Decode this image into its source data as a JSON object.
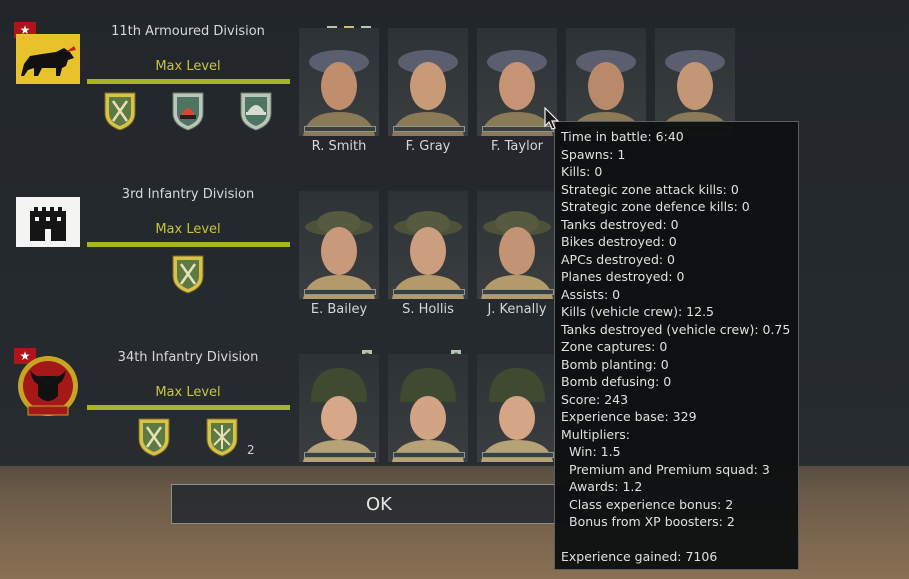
{
  "divisions": [
    {
      "name": "11th Armoured Division",
      "level": "Max Level",
      "flag_icon": "charging-bull-flag",
      "awards": [
        "crossed-swords-award",
        "flame-award",
        "helmet-award"
      ],
      "award_count": "",
      "soldiers": [
        {
          "name": "R. Smith",
          "headgear": "beret"
        },
        {
          "name": "F. Gray",
          "headgear": "beret"
        },
        {
          "name": "F. Taylor",
          "headgear": "beret"
        },
        {
          "name": "",
          "headgear": "beret"
        },
        {
          "name": "",
          "headgear": "beret"
        }
      ]
    },
    {
      "name": "3rd Infantry Division",
      "level": "Max Level",
      "flag_icon": "castle-flag",
      "awards": [
        "crossed-swords-award"
      ],
      "award_count": "",
      "soldiers": [
        {
          "name": "E. Bailey",
          "headgear": "brodie-helmet"
        },
        {
          "name": "S. Hollis",
          "headgear": "brodie-helmet"
        },
        {
          "name": "J. Kenally",
          "headgear": "brodie-helmet"
        }
      ]
    },
    {
      "name": "34th Infantry Division",
      "level": "Max Level",
      "flag_icon": "red-bull-flag",
      "awards": [
        "crossed-swords-award",
        "rifles-award"
      ],
      "award_count": "2",
      "soldiers": [
        {
          "name": "",
          "headgear": "m1-helmet"
        },
        {
          "name": "",
          "headgear": "m1-helmet"
        },
        {
          "name": "",
          "headgear": "m1-helmet"
        }
      ]
    }
  ],
  "ok_label": "OK",
  "tooltip": {
    "lines": [
      "Time in battle: 6:40",
      "Spawns: 1",
      "Kills: 0",
      "Strategic zone attack kills: 0",
      "Strategic zone defence kills: 0",
      "Tanks destroyed: 0",
      "Bikes destroyed: 0",
      "APCs destroyed: 0",
      "Planes destroyed: 0",
      "Assists: 0",
      "Kills (vehicle crew): 12.5",
      "Tanks destroyed (vehicle crew): 0.75",
      "Zone captures: 0",
      "Bomb planting: 0",
      "Bomb defusing: 0",
      "Score: 243",
      "Experience base: 329",
      "Multipliers:"
    ],
    "multipliers": [
      "Win: 1.5",
      "Premium and Premium squad: 3",
      "Awards: 1.2",
      "Class experience bonus: 2",
      "Bonus from XP boosters: 2"
    ],
    "total": "Experience gained: 7106"
  },
  "colors": {
    "level_text": "#c8c53a",
    "level_bar": "#a7b522",
    "flag_star": "#b0141b"
  }
}
